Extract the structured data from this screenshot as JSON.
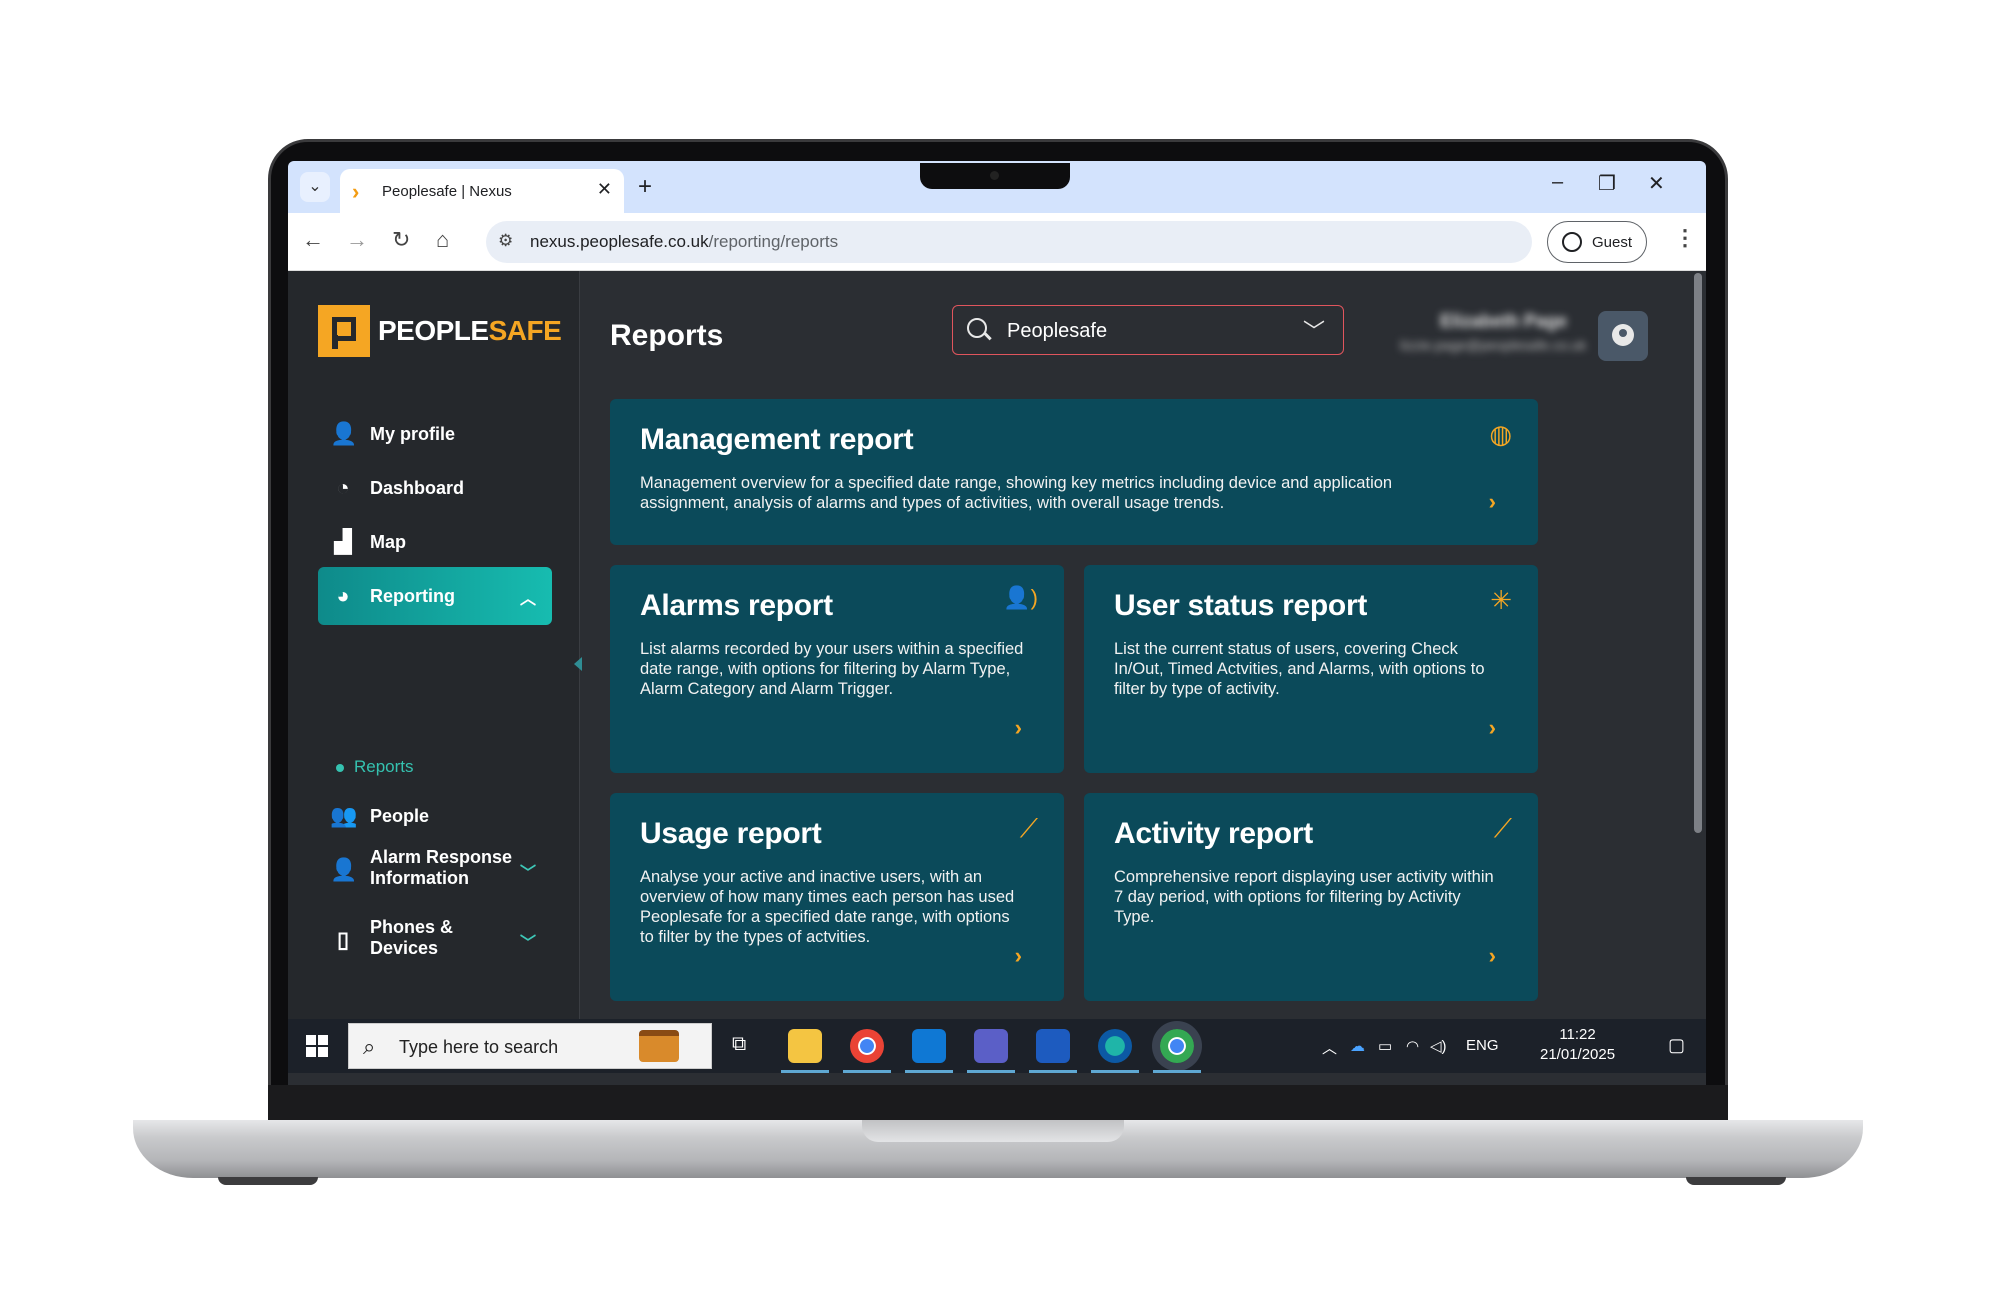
{
  "browser": {
    "tab_title": "Peoplesafe | Nexus",
    "tab_close": "✕",
    "new_tab": "+",
    "url_domain": "nexus.peoplesafe.co.uk",
    "url_path": "/reporting/reports",
    "profile_label": "Guest"
  },
  "brand": {
    "part1": "PEOPLE",
    "part2": "SAFE",
    "accent": "#f5a623",
    "teal": "#17bcb0"
  },
  "sidebar": {
    "items": [
      {
        "label": "My profile",
        "icon": "person-icon"
      },
      {
        "label": "Dashboard",
        "icon": "gauge-icon"
      },
      {
        "label": "Map",
        "icon": "map-icon"
      },
      {
        "label": "Reporting",
        "icon": "pie-chart-icon",
        "active": true
      },
      {
        "label": "People",
        "icon": "people-icon"
      },
      {
        "label": "Alarm Response Information",
        "icon": "alarm-user-icon"
      },
      {
        "label": "Phones & Devices",
        "icon": "device-icon"
      }
    ],
    "alarm_line1": "Alarm Response",
    "alarm_line2": "Information",
    "phones_line1": "Phones &",
    "phones_line2": "Devices",
    "sub_item": "Reports"
  },
  "header": {
    "title": "Reports",
    "org_select_value": "Peoplesafe",
    "user_name": "Elizabeth Page",
    "user_email": "lizzie.page@peoplesafe.co.uk"
  },
  "cards": [
    {
      "title": "Management report",
      "desc": "Management overview for a specified date range, showing key metrics including device and application assignment, analysis of alarms and types of activities, with overall usage trends.",
      "icon": "trend-circle-icon"
    },
    {
      "title": "Alarms report",
      "desc": "List alarms recorded by your users within a specified date range, with options for filtering by Alarm Type, Alarm Category and Alarm Trigger.",
      "icon": "alarm-user-icon"
    },
    {
      "title": "User status report",
      "desc": "List the current status of users, covering Check In/Out, Timed Actvities, and Alarms, with options to filter by type of activity.",
      "icon": "loading-spinner-icon"
    },
    {
      "title": "Usage report",
      "desc": "Analyse your active and inactive users, with an overview of how many times each person has used Peoplesafe for a specified date range, with options to filter by the types of actvities.",
      "icon": "sparkle-trend-icon"
    },
    {
      "title": "Activity report",
      "desc": "Comprehensive report displaying user activity within 7 day period, with options for filtering by Activity Type.",
      "icon": "trend-line-icon"
    }
  ],
  "taskbar": {
    "search_placeholder": "Type here to search",
    "lang": "ENG",
    "time": "11:22",
    "date": "21/01/2025"
  }
}
